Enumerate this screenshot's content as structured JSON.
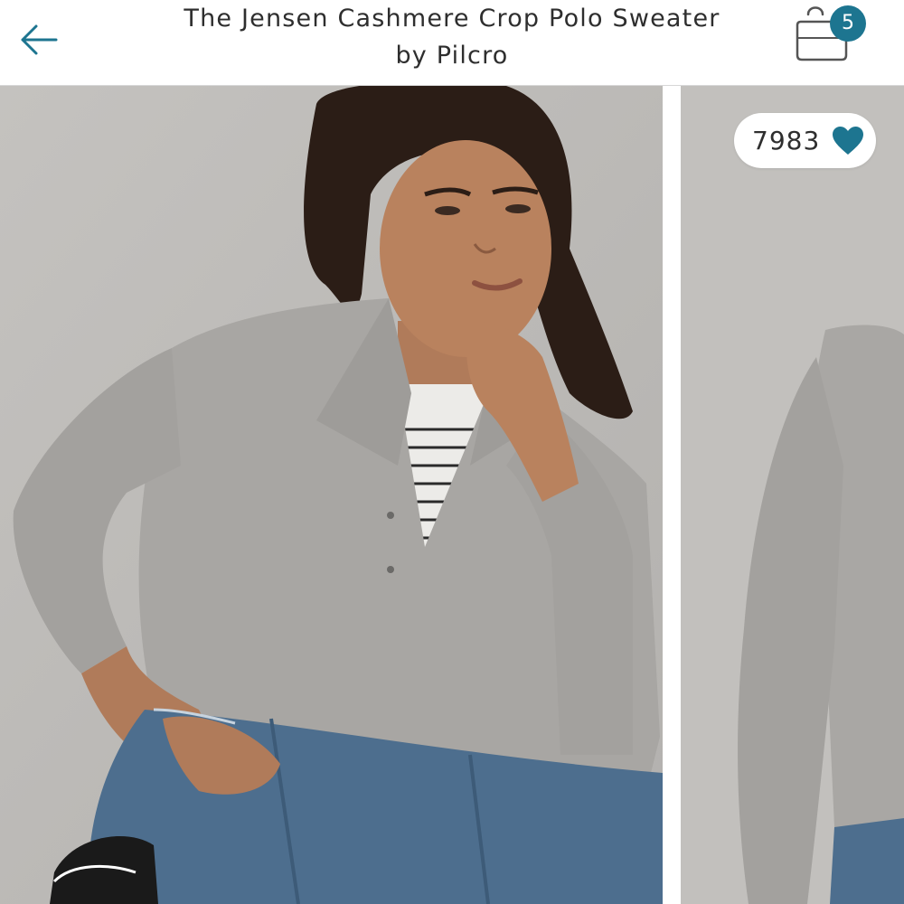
{
  "header": {
    "title_line1": "The Jensen Cashmere Crop Polo Sweater",
    "title_line2": "by Pilcro",
    "back_icon": "arrow-left-icon",
    "bag_icon": "shopping-bag-icon",
    "bag_count": "5"
  },
  "gallery": {
    "likes_count": "7983",
    "heart_icon": "heart-icon",
    "images": [
      {
        "alt": "Model wearing grey cashmere crop polo sweater over striped tee with blue jeans"
      },
      {
        "alt": "Side view of grey cashmere crop polo sweater"
      }
    ]
  },
  "colors": {
    "accent": "#1d7590",
    "title_text": "#2e2e2e",
    "backdrop": "#bdbbb8",
    "sweater": "#a8a6a3",
    "denim": "#4d6e8e"
  }
}
